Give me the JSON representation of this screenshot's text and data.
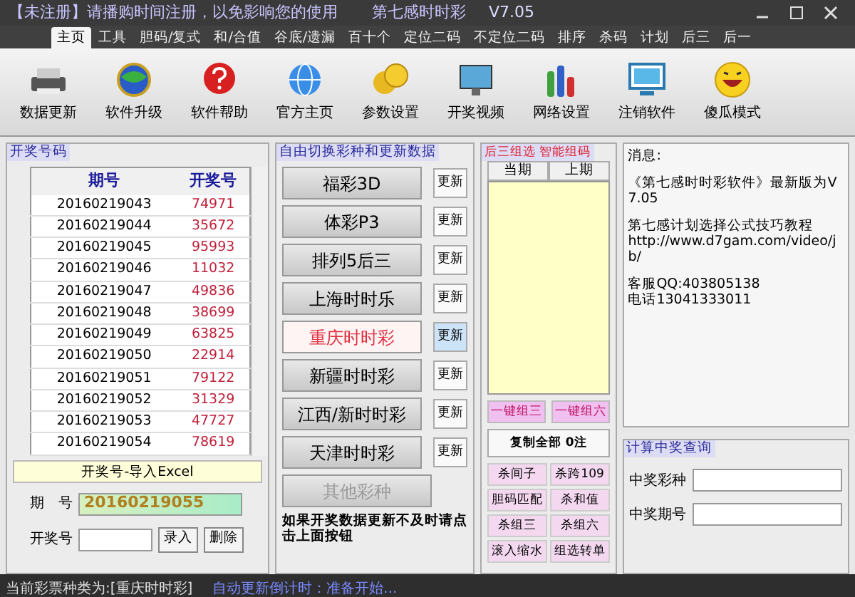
{
  "window": {
    "title": "【未注册】请播购时间注册，以免影响您的使用",
    "app_name": "第七感时时彩",
    "version": "V7.05"
  },
  "menu_tabs": [
    {
      "label": "主页",
      "selected": true
    },
    {
      "label": "工具",
      "selected": false
    },
    {
      "label": "胆码/复式",
      "selected": false
    },
    {
      "label": "和/合值",
      "selected": false
    },
    {
      "label": "谷底/遗漏",
      "selected": false
    },
    {
      "label": "百十个",
      "selected": false
    },
    {
      "label": "定位二码",
      "selected": false
    },
    {
      "label": "不定位二码",
      "selected": false
    },
    {
      "label": "排序",
      "selected": false
    },
    {
      "label": "杀码",
      "selected": false
    },
    {
      "label": "计划",
      "selected": false
    },
    {
      "label": "后三",
      "selected": false
    },
    {
      "label": "后一",
      "selected": false
    }
  ],
  "toolbar": [
    "数据更新",
    "软件升级",
    "软件帮助",
    "官方主页",
    "参数设置",
    "开奖视频",
    "网络设置",
    "注销软件",
    "傻瓜模式"
  ],
  "draw_panel": {
    "title": "开奖号码",
    "columns": [
      "期号",
      "开奖号"
    ],
    "rows": [
      [
        "20160219043",
        "74971"
      ],
      [
        "20160219044",
        "35672"
      ],
      [
        "20160219045",
        "95993"
      ],
      [
        "20160219046",
        "11032"
      ],
      [
        "20160219047",
        "49836"
      ],
      [
        "20160219048",
        "38699"
      ],
      [
        "20160219049",
        "63825"
      ],
      [
        "20160219050",
        "22914"
      ],
      [
        "20160219051",
        "79122"
      ],
      [
        "20160219052",
        "31329"
      ],
      [
        "20160219053",
        "47727"
      ],
      [
        "20160219054",
        "78619"
      ]
    ],
    "excel_button": "开奖号-导入Excel",
    "issue_label": "期　号",
    "issue_value": "20160219055",
    "number_label": "开奖号",
    "add_button": "录入",
    "delete_button": "删除"
  },
  "lottery_panel": {
    "title": "自由切换彩种和更新数据",
    "items": [
      {
        "label": "福彩3D",
        "selected": false,
        "disabled": false,
        "update": "更新"
      },
      {
        "label": "体彩P3",
        "selected": false,
        "disabled": false,
        "update": "更新"
      },
      {
        "label": "排列5后三",
        "selected": false,
        "disabled": false,
        "update": "更新"
      },
      {
        "label": "上海时时乐",
        "selected": false,
        "disabled": false,
        "update": "更新"
      },
      {
        "label": "重庆时时彩",
        "selected": true,
        "disabled": false,
        "update": "更新"
      },
      {
        "label": "新疆时时彩",
        "selected": false,
        "disabled": false,
        "update": "更新"
      },
      {
        "label": "江西/新时时彩",
        "selected": false,
        "disabled": false,
        "update": "更新"
      },
      {
        "label": "天津时时彩",
        "selected": false,
        "disabled": false,
        "update": "更新"
      },
      {
        "label": "其他彩种",
        "selected": false,
        "disabled": true
      }
    ],
    "note": "如果开奖数据更新不及时请点击上面按钮"
  },
  "combo_panel": {
    "title": "后三组选 智能组码",
    "columns": [
      "当期",
      "上期"
    ],
    "buttons_top": [
      "一键组三",
      "一键组六"
    ],
    "copy_all": "复制全部 0注",
    "buttons": [
      "杀间子",
      "杀跨109",
      "胆码匹配",
      "杀和值",
      "杀组三",
      "杀组六",
      "滚入缩水",
      "组选转单"
    ]
  },
  "message_panel": {
    "label": "消息:",
    "lines": [
      "《第七感时时彩软件》最新版为V7.05",
      "第七感计划选择公式技巧教程",
      "http://www.d7gam.com/video/jb/",
      "客服QQ:403805138",
      "电话13041333011"
    ]
  },
  "prize_panel": {
    "title": "计算中奖查询",
    "fields": [
      {
        "label": "中奖彩种"
      },
      {
        "label": "中奖期号"
      }
    ]
  },
  "status_bar": [
    "当前彩票种类为:[重庆时时彩]",
    "自动更新倒计时：准备开始..."
  ]
}
